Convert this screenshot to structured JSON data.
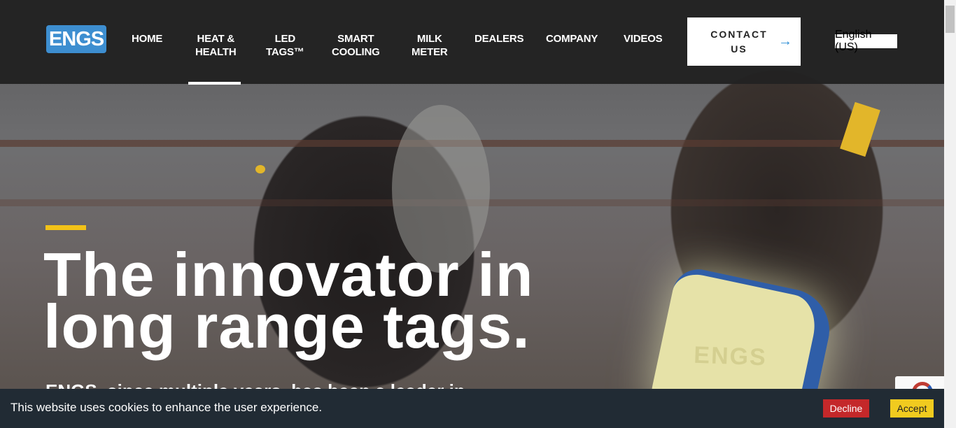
{
  "header": {
    "logo_text": "ENGS",
    "nav": [
      {
        "line1": "HOME",
        "line2": ""
      },
      {
        "line1": "HEAT &",
        "line2": "HEALTH"
      },
      {
        "line1": "LED",
        "line2": "TAGS™"
      },
      {
        "line1": "SMART",
        "line2": "COOLING"
      },
      {
        "line1": "MILK",
        "line2": "METER"
      },
      {
        "line1": "DEALERS",
        "line2": ""
      },
      {
        "line1": "COMPANY",
        "line2": ""
      },
      {
        "line1": "VIDEOS",
        "line2": ""
      }
    ],
    "active_nav": "HEAT & HEALTH",
    "contact": {
      "line1": "CONTACT",
      "line2": "US",
      "arrow": "→"
    },
    "language": "English (US)"
  },
  "hero": {
    "headline_line1": "The innovator in",
    "headline_line2": "long range tags.",
    "subtext_partial": "ENGS, since multiple years, has been a leader in",
    "device_emboss": "ENGS"
  },
  "cookie_bar": {
    "message": "This website uses cookies to enhance the user experience.",
    "decline_label": "Decline",
    "accept_label": "Accept"
  },
  "colors": {
    "accent_yellow": "#f2c218",
    "logo_blue": "#3d8ed0",
    "decline_red": "#c4282a",
    "accept_yellow": "#f1cb1f",
    "cookie_bg": "#212b34"
  }
}
